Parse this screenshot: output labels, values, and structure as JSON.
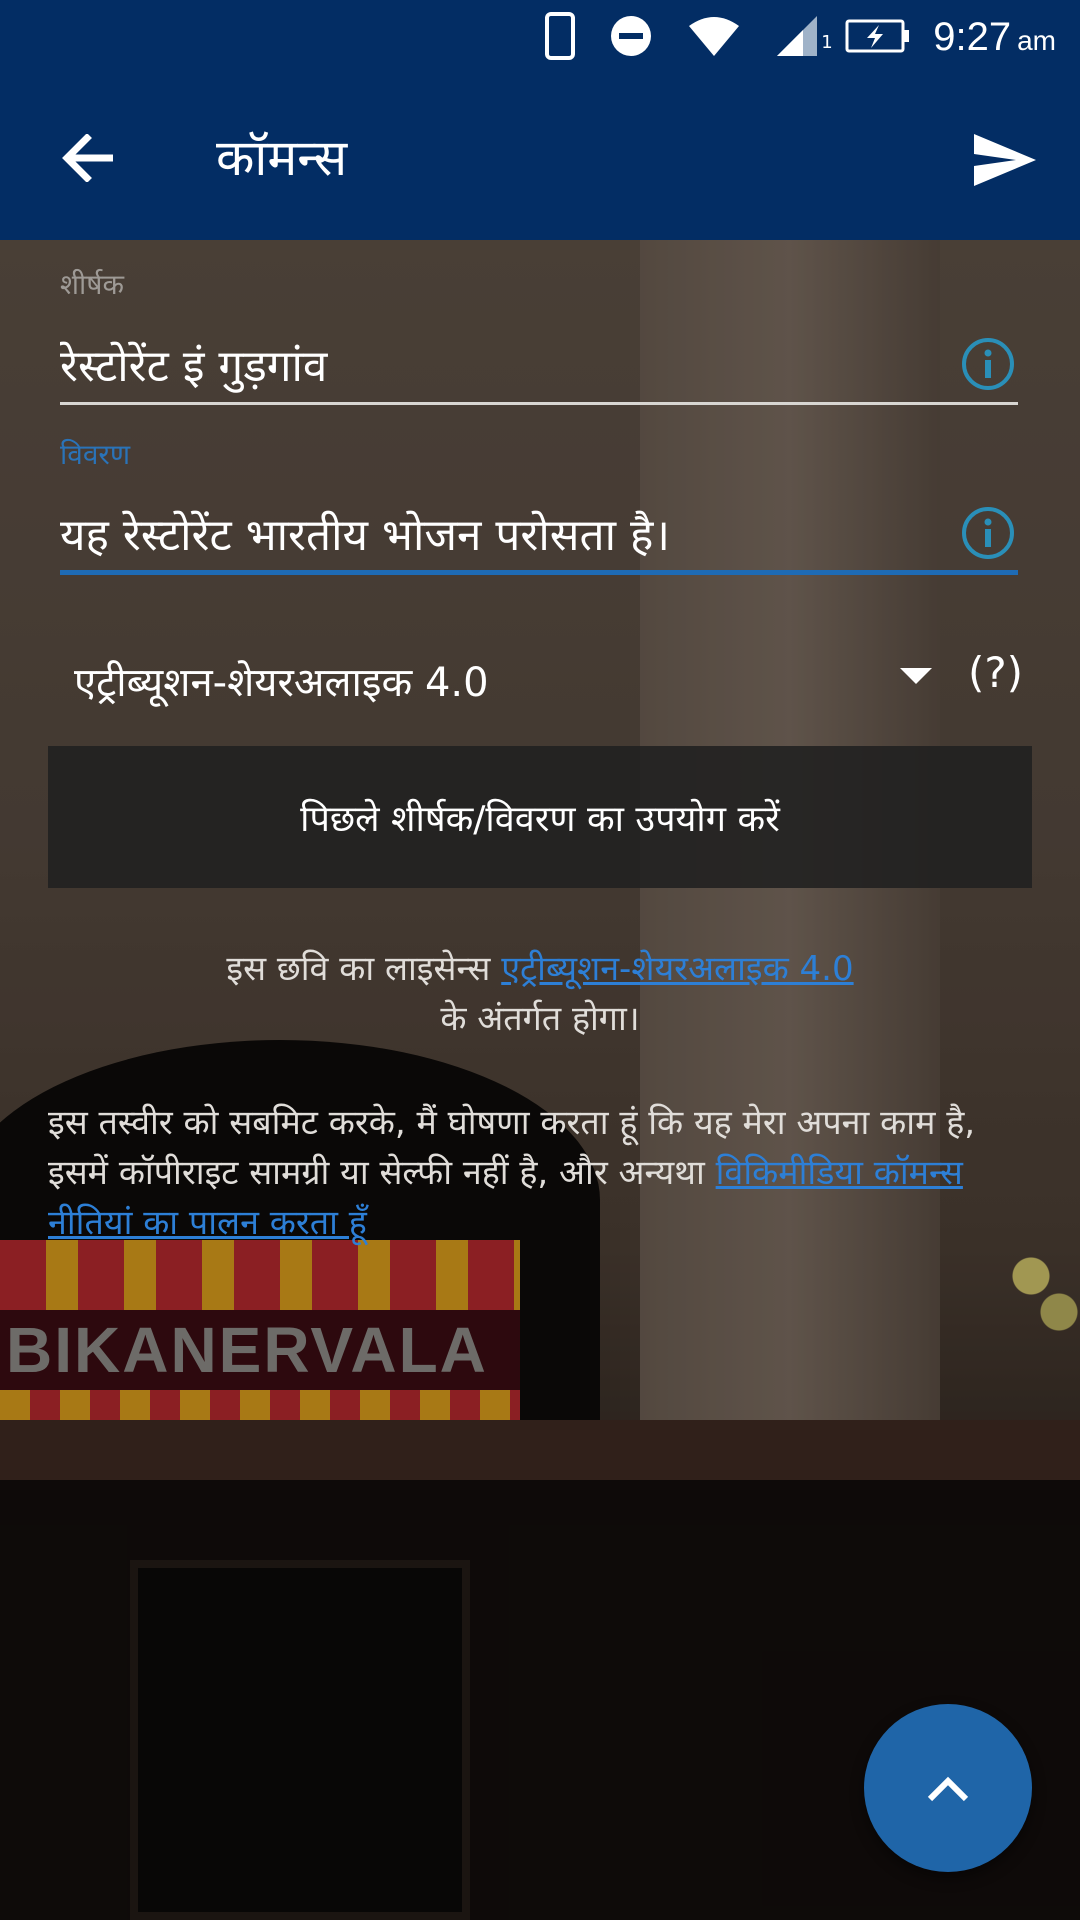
{
  "status_bar": {
    "time": "9:27",
    "ampm": "am",
    "sim_slot": "1",
    "icons": [
      "phone-icon",
      "dnd-icon",
      "wifi-icon",
      "signal-icon",
      "battery-charging-icon"
    ]
  },
  "app_bar": {
    "title": "कॉमन्स",
    "back_icon": "arrow-left-icon",
    "send_icon": "send-icon"
  },
  "form": {
    "title_label": "शीर्षक",
    "title_value": "रेस्टोरेंट इं गुड़गांव",
    "description_label": "विवरण",
    "description_value": "यह रेस्टोरेंट भारतीय भोजन परोसता है।",
    "license_selected": "एट्रीब्यूशन-शेयरअलाइक 4.0",
    "license_help": "(?)",
    "previous_button_label": "पिछले शीर्षक/विवरण का उपयोग करें"
  },
  "license_note": {
    "prefix": "इस छवि का लाइसेन्स ",
    "link": "एट्रीब्यूशन-शेयरअलाइक 4.0",
    "suffix": "के अंतर्गत होगा।"
  },
  "declaration": {
    "text": "इस तस्वीर को सबमिट करके, मैं घोषणा करता हूं कि यह मेरा अपना काम है, इसमें कॉपीराइट सामग्री या सेल्फी नहीं है, और अन्यथा ",
    "link": "विकिमीडिया कॉमन्स नीतियां का पालन करता हूँ"
  },
  "background_photo": {
    "sign_text": "BIKANERVALA"
  },
  "fab": {
    "icon": "chevron-up-icon"
  },
  "colors": {
    "primary": "#032d64",
    "accent": "#1e6bb5",
    "link": "#2d7fd6",
    "fab": "#1f65a8",
    "info_icon": "#2a8fb8"
  }
}
